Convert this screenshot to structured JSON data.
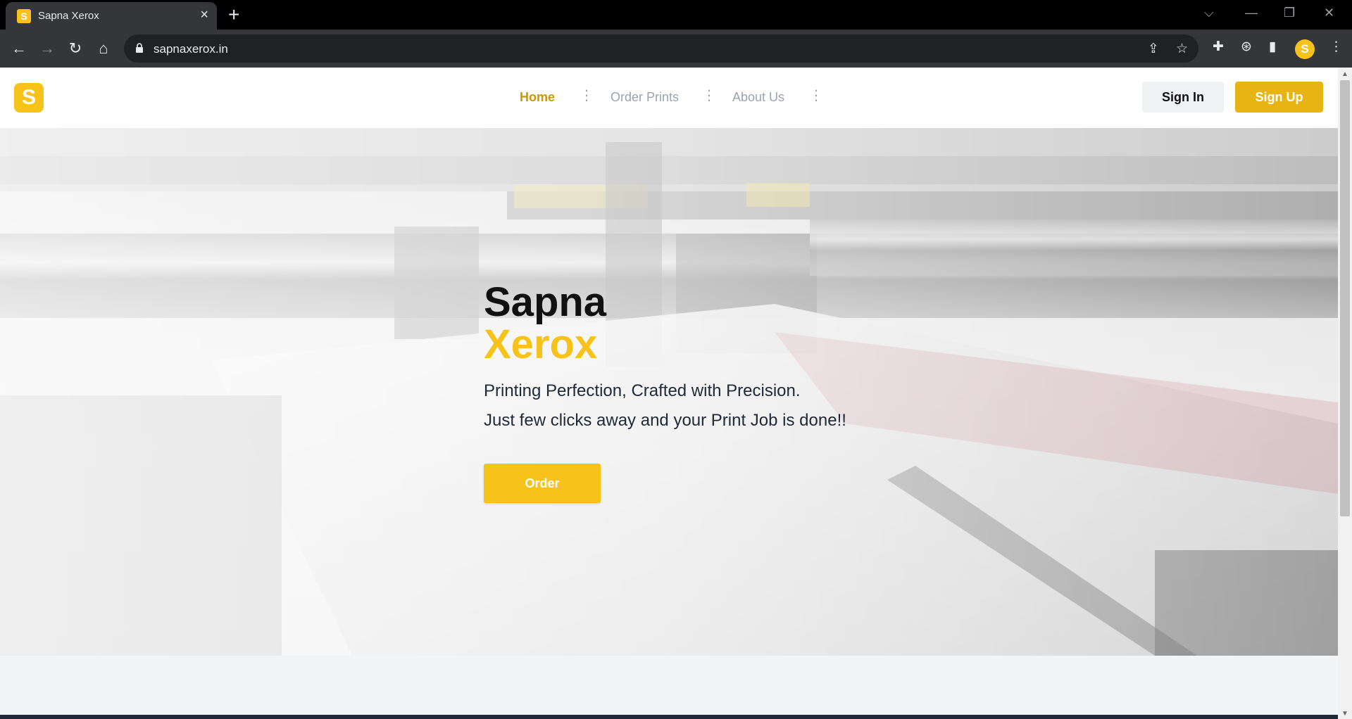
{
  "browser": {
    "tab_title": "Sapna Xerox",
    "tab_favicon_letter": "S",
    "url": "sapnaxerox.in",
    "profile_letter": "S",
    "icons": {
      "back": "arrow-left-icon",
      "forward": "arrow-right-icon",
      "reload": "reload-icon",
      "home": "home-icon",
      "share": "share-icon",
      "bookmark": "star-icon",
      "extensions": "puzzle-icon",
      "sidebar": "side-panel-icon"
    }
  },
  "site": {
    "logo_letter": "S",
    "nav": [
      {
        "label": "Home",
        "active": true
      },
      {
        "label": "Order Prints",
        "active": false
      },
      {
        "label": "About Us",
        "active": false
      }
    ],
    "signin_label": "Sign In",
    "signup_label": "Sign Up"
  },
  "hero": {
    "title_line1": "Sapna",
    "title_line2": "Xerox",
    "tagline1": "Printing Perfection, Crafted with Precision.",
    "tagline2": "Just few clicks away and your Print Job is done!!",
    "order_label": "Order"
  },
  "colors": {
    "brand_yellow": "#f7c31a",
    "active_nav": "#c99a06",
    "signup_bg": "#e6b413"
  }
}
